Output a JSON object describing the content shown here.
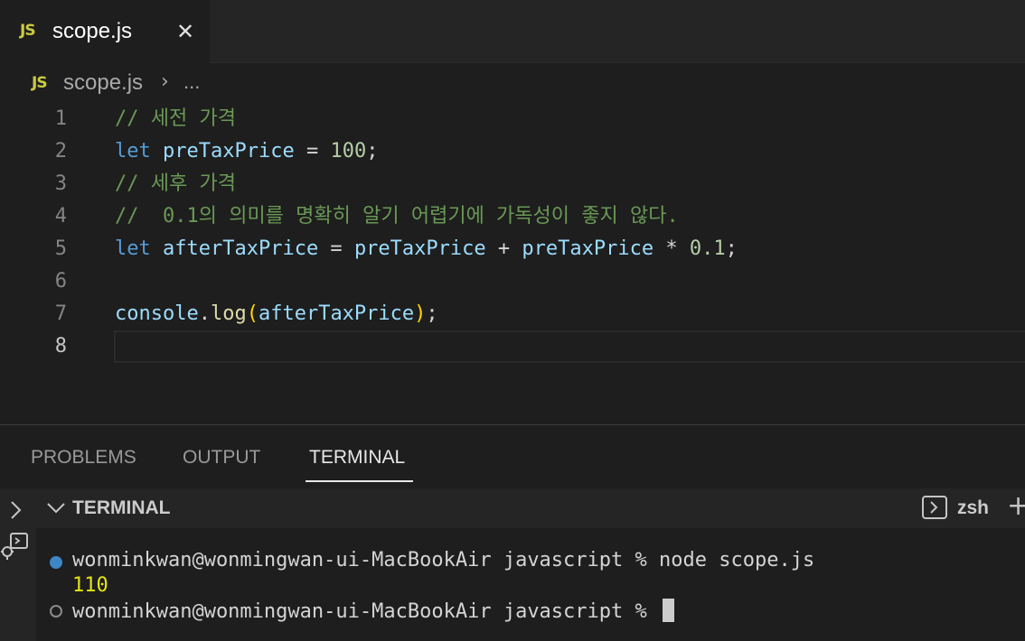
{
  "tab": {
    "badge": "JS",
    "label": "scope.js",
    "close": "✕"
  },
  "breadcrumb": {
    "badge": "JS",
    "file": "scope.js",
    "sep": "›",
    "more": "..."
  },
  "editor": {
    "line_numbers": [
      "1",
      "2",
      "3",
      "4",
      "5",
      "6",
      "7",
      "8"
    ],
    "active_line": 8,
    "lines": [
      {
        "comment": "// 세전 가격"
      },
      {
        "kw": "let",
        "var": "preTaxPrice",
        "eq": " = ",
        "num": "100",
        "end": ";"
      },
      {
        "comment": "// 세후 가격"
      },
      {
        "comment": "//  0.1의 의미를 명확히 알기 어렵기에 가독성이 좋지 않다."
      },
      {
        "kw": "let",
        "var1": "afterTaxPrice",
        "eq": " = ",
        "var2": "preTaxPrice",
        "plus": " + ",
        "var3": "preTaxPrice",
        "mul": " * ",
        "num": "0.1",
        "end": ";"
      },
      {},
      {
        "obj": "console",
        "dot": ".",
        "fn": "log",
        "open": "(",
        "arg": "afterTaxPrice",
        "close": ")",
        "end": ";"
      },
      {}
    ]
  },
  "panel": {
    "tabs": [
      "PROBLEMS",
      "OUTPUT",
      "TERMINAL"
    ],
    "active_tab": "TERMINAL",
    "terminal_title": "TERMINAL",
    "shell": "zsh",
    "add": "+",
    "lines": [
      "wonminkwan@wonmingwan-ui-MacBookAir javascript % node scope.js",
      "110",
      "wonminkwan@wonmingwan-ui-MacBookAir javascript % "
    ]
  },
  "colors": {
    "comment": "#6a9955",
    "keyword": "#569cd6",
    "variable": "#9cdcfe",
    "number": "#b5cea8",
    "function": "#dcdcaa",
    "js_badge": "#cbcb41",
    "terminal_dot": "#3c87c4"
  }
}
